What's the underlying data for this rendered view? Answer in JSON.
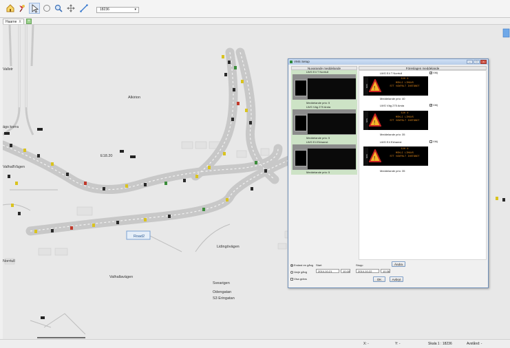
{
  "toolbar": {
    "scale_value": "18236",
    "icons": [
      "home-icon",
      "pin-icon",
      "pointer-icon",
      "circle-select-icon",
      "zoom-icon",
      "pan-icon",
      "measure-icon"
    ]
  },
  "tab": {
    "label": "Haarne",
    "close": "X",
    "add": "+"
  },
  "map_labels": {
    "alkirion": "Alkirion",
    "e1820": "E18.20",
    "lidingovagen": "Lidingövägen",
    "valhallavagen": "Valhallavägen",
    "svearigen": "Svearigen",
    "odengatan": "Odengatan",
    "s3_eringatan": "S3 Eringatan",
    "road_tag": "Road2",
    "left_1": "Vallstr",
    "left_2": "ägs korra",
    "left_3": "ValhallVägen",
    "left_4": "Norrtull"
  },
  "dialog": {
    "title": "VMS Setup",
    "left_header": "Nuvarande meddelande",
    "right_header": "Föreslagen meddelande",
    "signs": [
      {
        "left_name": "LWG E4 T Norrtull",
        "left_prio": "Meddelande prio: 5",
        "right_name": "LWG E4 T Norrtull",
        "right_prio": "Meddelande prio: 40",
        "select_label": "Välj",
        "lines": [
          "E20 0",
          "MÖKLI LIMAVS",
          "STT VÄXPÄLT INSTÄNDT"
        ]
      },
      {
        "left_name": "LWG Väg 275 Arsta",
        "left_prio": "Meddelande prio: 5",
        "right_name": "LWG Väg 275 Arsta",
        "right_prio": "Meddelande prio: 35",
        "select_label": "Välj",
        "lines": [
          "E20 0",
          "MÖKLI LIMAVS",
          "STT VÄXPÄLT INSTÄNDT"
        ]
      },
      {
        "left_name": "LWG E4 Ekhamst",
        "left_prio": "Meddelande prio: 5",
        "right_name": "LWG E4 Ekhamst",
        "right_prio": "Meddelande prio: 35",
        "select_label": "Välj",
        "lines": [
          "E20 0",
          "MÖKLI LIMAVS",
          "STT VÄXPÄLT INSTÄNDT"
        ]
      }
    ],
    "side_label": "SKN",
    "radio_1": "Endast en gång",
    "radio_2": "Varje gång",
    "check_1": "Visa gräns",
    "from_label": "Start",
    "to_label": "Stopp",
    "from_date": "2014-10-21",
    "from_time": "10:18",
    "to_date": "2014-10-22",
    "to_time": "10:36",
    "apply_label": "Ändra",
    "ok_label": "OK",
    "cancel_label": "Avbryt"
  },
  "status": {
    "x_label": "X: -",
    "y_label": "Y: -",
    "scale": "Skala 1 : 18236",
    "distance": "Avstånd: -"
  },
  "colors": {
    "map_bg": "#e8e8e8",
    "road": "#c8c8c8",
    "vms_text": "#e08a1e",
    "pane_green": "#cde3c6"
  }
}
